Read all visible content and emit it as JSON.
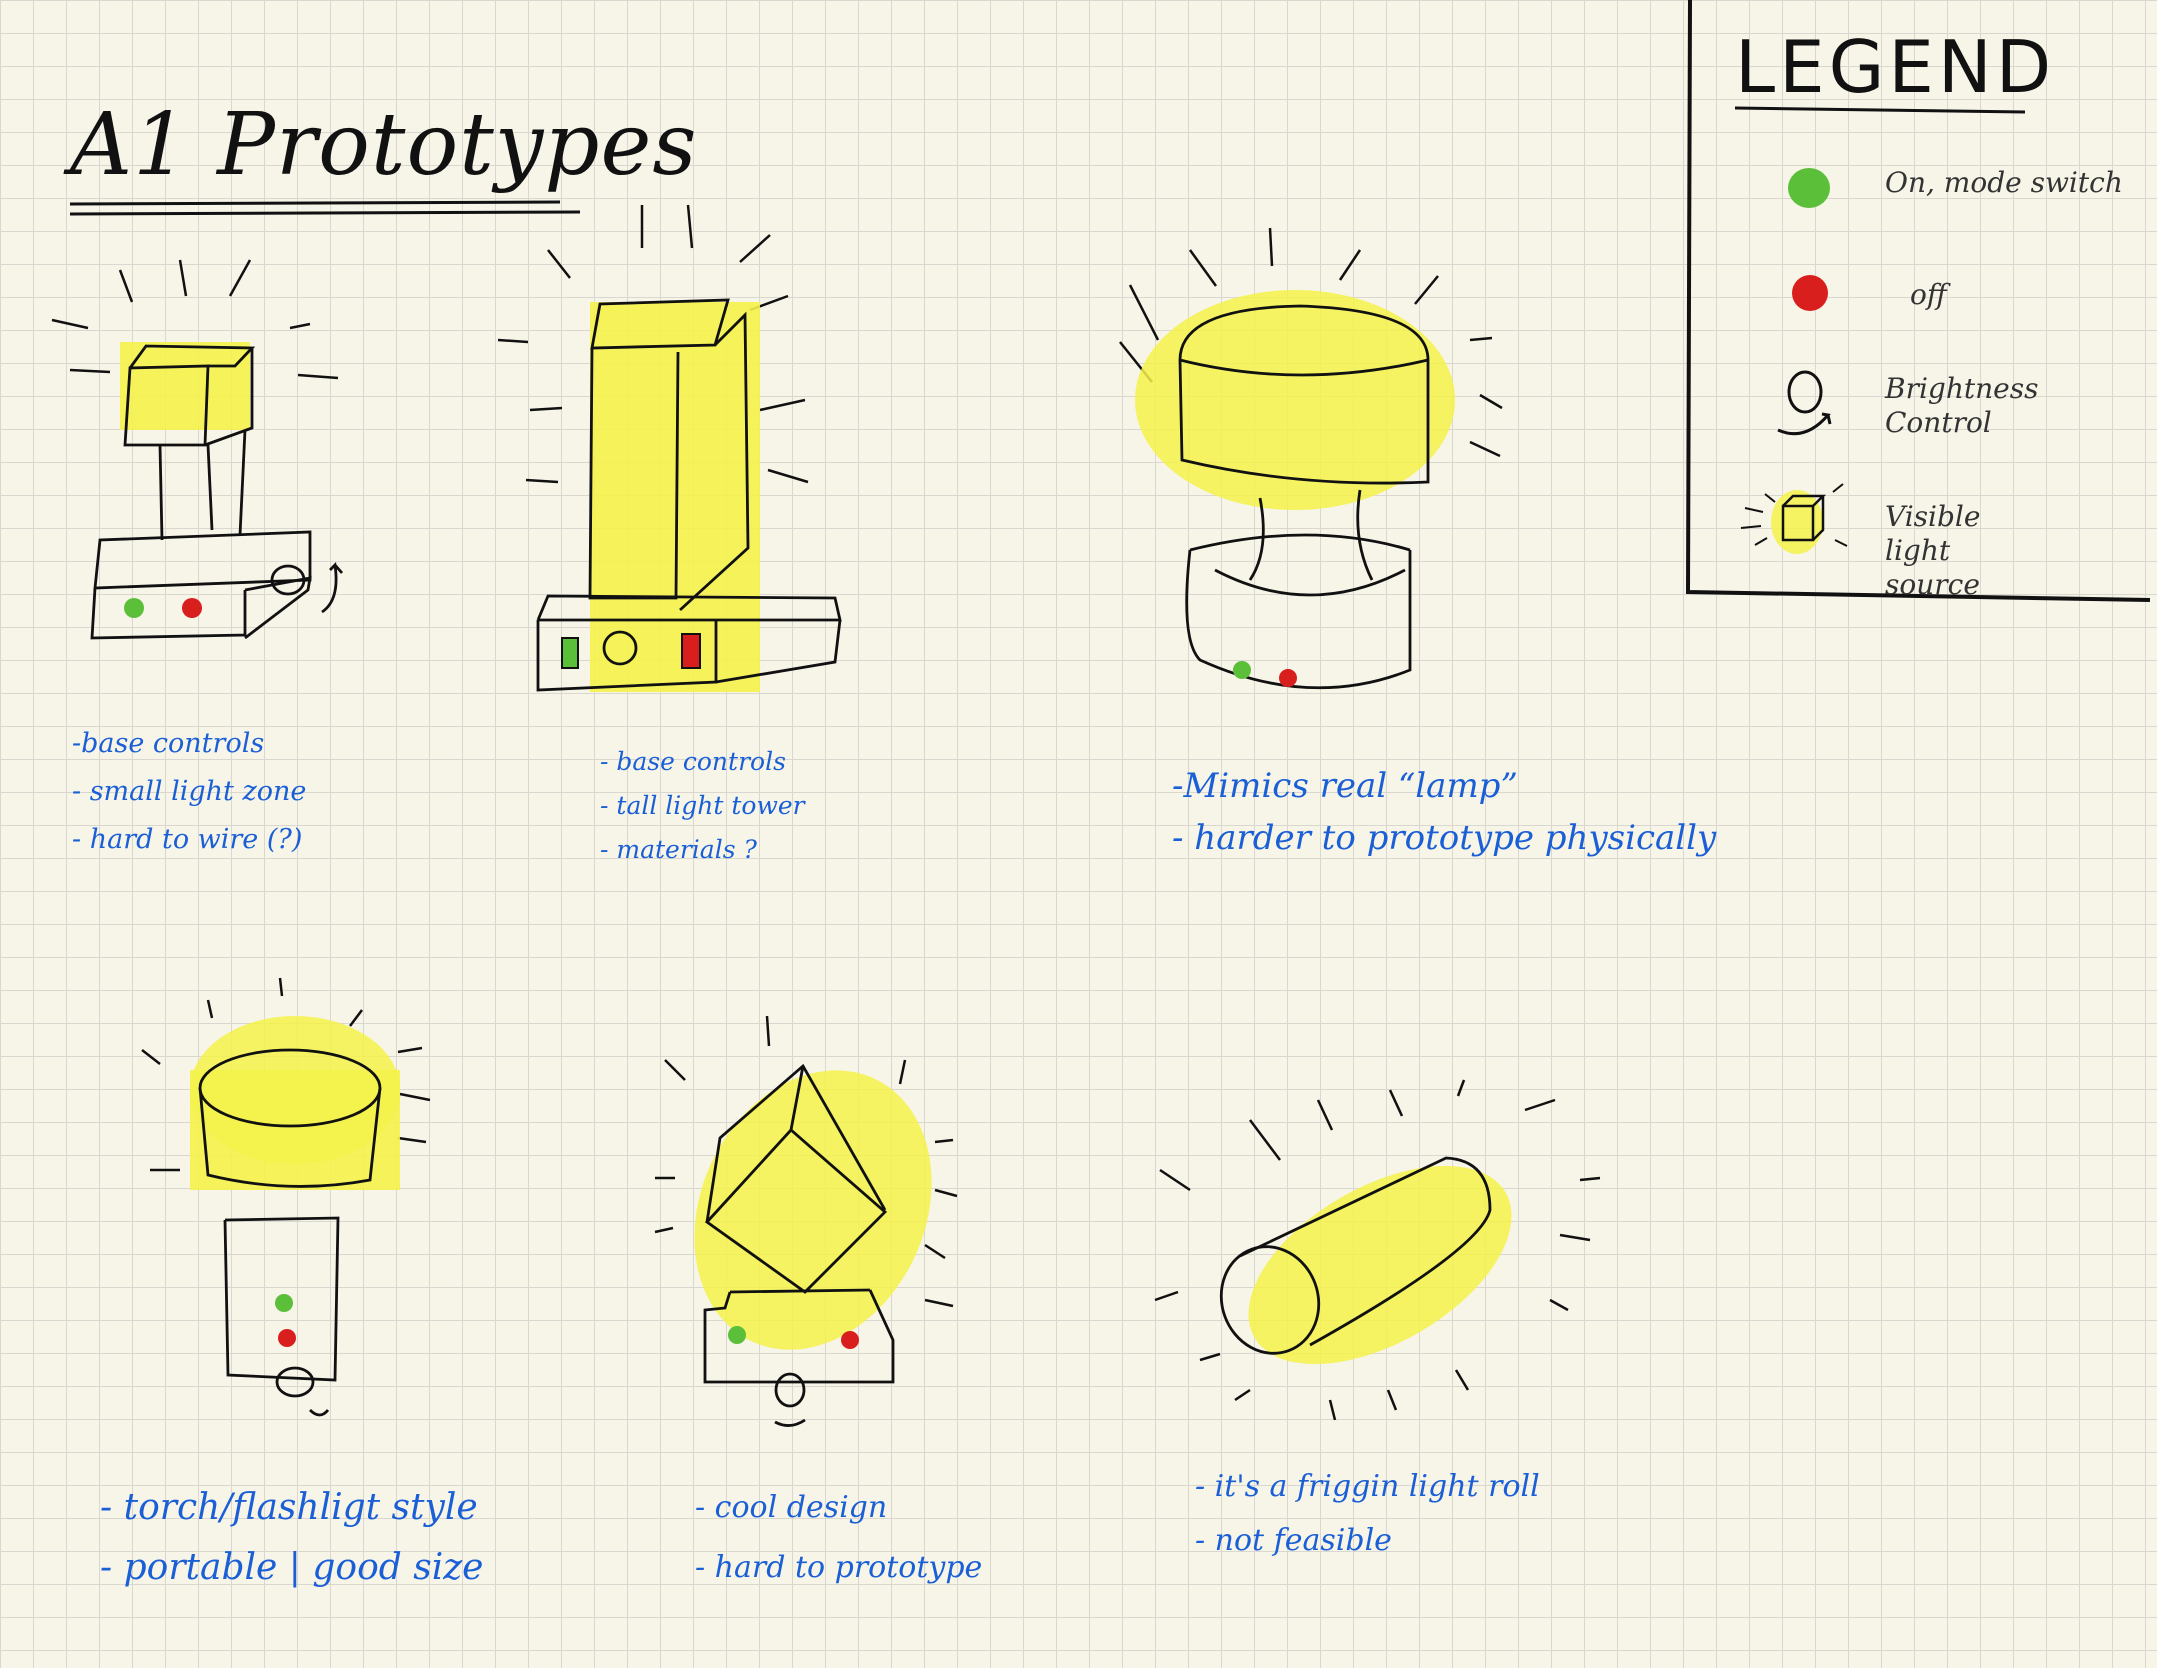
{
  "title": "A1 Prototypes",
  "legend": {
    "title": "LEGEND",
    "items": [
      {
        "label": "On, mode switch",
        "color": "#5cbf3a",
        "icon": "green-dot"
      },
      {
        "label": "off",
        "color": "#d91e1e",
        "icon": "red-dot"
      },
      {
        "label": "Brightness Control",
        "icon": "rotate-knob-icon"
      },
      {
        "label": "Visible light source",
        "color": "#f4f24a",
        "icon": "glowing-cube-icon"
      }
    ]
  },
  "prototypes": [
    {
      "id": "p1",
      "notes": [
        "-base controls",
        "- small light zone",
        "- hard to wire (?)"
      ]
    },
    {
      "id": "p2",
      "notes": [
        "- base controls",
        "- tall light tower",
        "- materials ?"
      ]
    },
    {
      "id": "p3",
      "notes": [
        "-Mimics real “lamp”",
        "- harder to prototype physically"
      ]
    },
    {
      "id": "p4",
      "notes": [
        "- torch/flashligt style",
        "- portable | good size"
      ]
    },
    {
      "id": "p5",
      "notes": [
        "- cool design",
        "- hard to prototype"
      ]
    },
    {
      "id": "p6",
      "notes": [
        "- it's a friggin light roll",
        "- not feasible"
      ]
    }
  ],
  "colors": {
    "ink": "#111111",
    "note_blue": "#1a5fd6",
    "highlight": "#f4f24a",
    "green": "#5cbf3a",
    "red": "#d91e1e"
  }
}
